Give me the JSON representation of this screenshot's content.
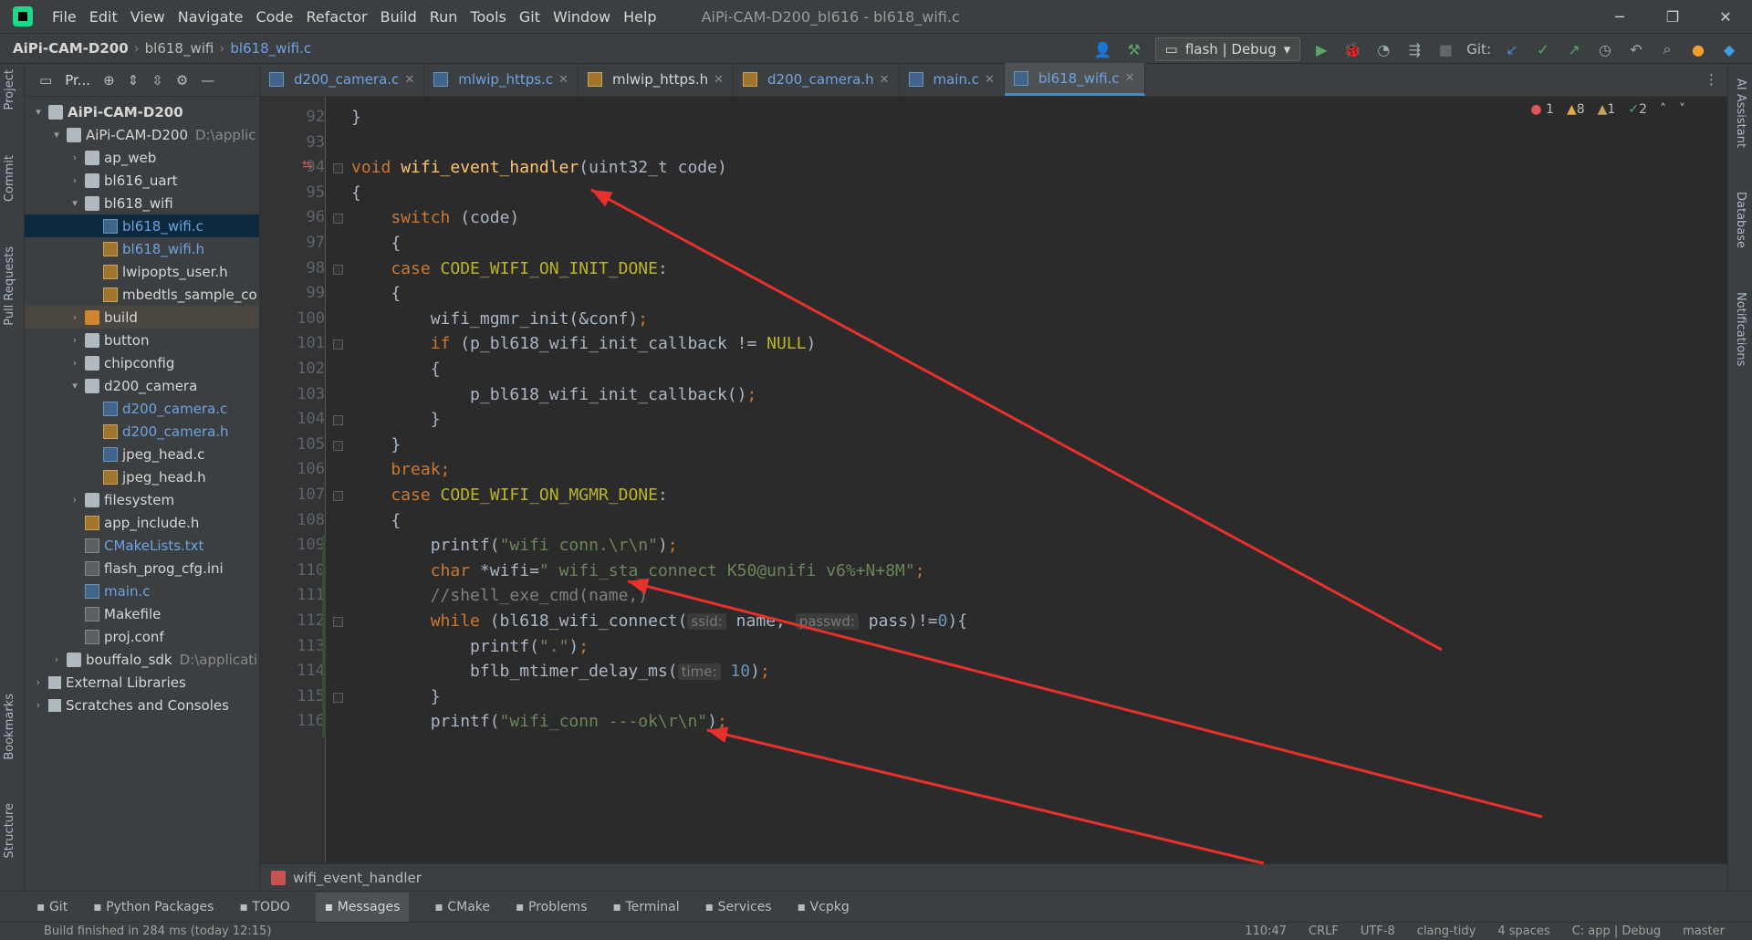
{
  "titlebar": {
    "menu": [
      "File",
      "Edit",
      "View",
      "Navigate",
      "Code",
      "Refactor",
      "Build",
      "Run",
      "Tools",
      "Git",
      "Window",
      "Help"
    ],
    "title": "AiPi-CAM-D200_bl616 - bl618_wifi.c"
  },
  "navbar": {
    "crumbs": [
      "AiPi-CAM-D200",
      "bl618_wifi",
      "bl618_wifi.c"
    ],
    "run_config": "flash | Debug",
    "git_label": "Git:"
  },
  "left_strip": [
    "Project",
    "Commit",
    "Pull Requests",
    "Bookmarks",
    "Structure"
  ],
  "right_strip": [
    "AI Assistant",
    "Database",
    "Notifications"
  ],
  "project_panel": {
    "title": "Pr...",
    "tree": [
      {
        "label": "AiPi-CAM-D200",
        "depth": 0,
        "arrow": "▾",
        "icon": "folder",
        "bold": true
      },
      {
        "label": "AiPi-CAM-D200",
        "extra": "D:\\applic",
        "depth": 1,
        "arrow": "▾",
        "icon": "folder"
      },
      {
        "label": "ap_web",
        "depth": 2,
        "arrow": "›",
        "icon": "folder"
      },
      {
        "label": "bl616_uart",
        "depth": 2,
        "arrow": "›",
        "icon": "folder"
      },
      {
        "label": "bl618_wifi",
        "depth": 2,
        "arrow": "▾",
        "icon": "folder"
      },
      {
        "label": "bl618_wifi.c",
        "depth": 3,
        "arrow": "",
        "icon": "c",
        "blue": true,
        "sel": true
      },
      {
        "label": "bl618_wifi.h",
        "depth": 3,
        "arrow": "",
        "icon": "h",
        "blue": true
      },
      {
        "label": "lwipopts_user.h",
        "depth": 3,
        "arrow": "",
        "icon": "h"
      },
      {
        "label": "mbedtls_sample_co",
        "depth": 3,
        "arrow": "",
        "icon": "h"
      },
      {
        "label": "build",
        "depth": 2,
        "arrow": "›",
        "icon": "folder-orange",
        "hl": true
      },
      {
        "label": "button",
        "depth": 2,
        "arrow": "›",
        "icon": "folder"
      },
      {
        "label": "chipconfig",
        "depth": 2,
        "arrow": "›",
        "icon": "folder"
      },
      {
        "label": "d200_camera",
        "depth": 2,
        "arrow": "▾",
        "icon": "folder"
      },
      {
        "label": "d200_camera.c",
        "depth": 3,
        "arrow": "",
        "icon": "c",
        "blue": true
      },
      {
        "label": "d200_camera.h",
        "depth": 3,
        "arrow": "",
        "icon": "h",
        "blue": true
      },
      {
        "label": "jpeg_head.c",
        "depth": 3,
        "arrow": "",
        "icon": "c"
      },
      {
        "label": "jpeg_head.h",
        "depth": 3,
        "arrow": "",
        "icon": "h"
      },
      {
        "label": "filesystem",
        "depth": 2,
        "arrow": "›",
        "icon": "folder"
      },
      {
        "label": "app_include.h",
        "depth": 2,
        "arrow": "",
        "icon": "h"
      },
      {
        "label": "CMakeLists.txt",
        "depth": 2,
        "arrow": "",
        "icon": "t",
        "blue": true
      },
      {
        "label": "flash_prog_cfg.ini",
        "depth": 2,
        "arrow": "",
        "icon": "t"
      },
      {
        "label": "main.c",
        "depth": 2,
        "arrow": "",
        "icon": "c",
        "blue": true
      },
      {
        "label": "Makefile",
        "depth": 2,
        "arrow": "",
        "icon": "t"
      },
      {
        "label": "proj.conf",
        "depth": 2,
        "arrow": "",
        "icon": "t"
      },
      {
        "label": "bouffalo_sdk",
        "extra": "D:\\applicati",
        "depth": 1,
        "arrow": "›",
        "icon": "folder"
      },
      {
        "label": "External Libraries",
        "depth": 0,
        "arrow": "›",
        "icon": "lib"
      },
      {
        "label": "Scratches and Consoles",
        "depth": 0,
        "arrow": "›",
        "icon": "lib"
      }
    ]
  },
  "tabs": [
    {
      "label": "d200_camera.c",
      "type": "c",
      "blue": true
    },
    {
      "label": "mlwip_https.c",
      "type": "c",
      "blue": true
    },
    {
      "label": "mlwip_https.h",
      "type": "h",
      "blue": false
    },
    {
      "label": "d200_camera.h",
      "type": "h",
      "blue": true
    },
    {
      "label": "main.c",
      "type": "c",
      "blue": true
    },
    {
      "label": "bl618_wifi.c",
      "type": "c",
      "blue": true,
      "active": true
    }
  ],
  "inspections": {
    "errors": "1",
    "warnings": "8",
    "weak": "1",
    "ok": "2"
  },
  "line_numbers": [
    "92",
    "93",
    "94",
    "95",
    "96",
    "97",
    "98",
    "99",
    "100",
    "101",
    "102",
    "103",
    "104",
    "105",
    "106",
    "107",
    "108",
    "109",
    "110",
    "111",
    "112",
    "113",
    "114",
    "115",
    "116"
  ],
  "code_lines": [
    [
      {
        "t": "}",
        "c": ""
      }
    ],
    [],
    [
      {
        "t": "void ",
        "c": "kw"
      },
      {
        "t": "wifi_event_handler",
        "c": "fn"
      },
      {
        "t": "(uint32_t code)",
        "c": ""
      }
    ],
    [
      {
        "t": "{",
        "c": ""
      }
    ],
    [
      {
        "t": "    switch ",
        "c": "kw"
      },
      {
        "t": "(code)",
        "c": ""
      }
    ],
    [
      {
        "t": "    {",
        "c": ""
      }
    ],
    [
      {
        "t": "    case ",
        "c": "kw"
      },
      {
        "t": "CODE_WIFI_ON_INIT_DONE",
        "c": "macro"
      },
      {
        "t": ":",
        "c": ""
      }
    ],
    [
      {
        "t": "    {",
        "c": ""
      }
    ],
    [
      {
        "t": "        wifi_mgmr_init(&conf)",
        "c": ""
      },
      {
        "t": ";",
        "c": "kw"
      }
    ],
    [
      {
        "t": "        if ",
        "c": "kw"
      },
      {
        "t": "(p_bl618_wifi_init_callback != ",
        "c": ""
      },
      {
        "t": "NULL",
        "c": "macro"
      },
      {
        "t": ")",
        "c": ""
      }
    ],
    [
      {
        "t": "        {",
        "c": ""
      }
    ],
    [
      {
        "t": "            p_bl618_wifi_init_callback()",
        "c": ""
      },
      {
        "t": ";",
        "c": "kw"
      }
    ],
    [
      {
        "t": "        }",
        "c": ""
      }
    ],
    [
      {
        "t": "    }",
        "c": ""
      }
    ],
    [
      {
        "t": "    break;",
        "c": "kw"
      }
    ],
    [
      {
        "t": "    case ",
        "c": "kw"
      },
      {
        "t": "CODE_WIFI_ON_MGMR_DONE",
        "c": "macro"
      },
      {
        "t": ":",
        "c": ""
      }
    ],
    [
      {
        "t": "    {",
        "c": ""
      }
    ],
    [
      {
        "t": "        printf(",
        "c": ""
      },
      {
        "t": "\"wifi conn.\\r\\n\"",
        "c": "str"
      },
      {
        "t": ")",
        "c": ""
      },
      {
        "t": ";",
        "c": "kw"
      }
    ],
    [
      {
        "t": "        char ",
        "c": "kw"
      },
      {
        "t": "*wifi=",
        "c": ""
      },
      {
        "t": "\" wifi_sta_connect K50@unifi v6%+N+8M\"",
        "c": "str"
      },
      {
        "t": ";",
        "c": "kw"
      }
    ],
    [
      {
        "t": "        //shell_exe_cmd(name,)",
        "c": "cmt"
      }
    ],
    [
      {
        "t": "        while ",
        "c": "kw"
      },
      {
        "t": "(bl618_wifi_connect(",
        "c": ""
      },
      {
        "t": "ssid:",
        "c": "hint"
      },
      {
        "t": " name, ",
        "c": ""
      },
      {
        "t": "passwd:",
        "c": "hint"
      },
      {
        "t": " pass)!=",
        "c": ""
      },
      {
        "t": "0",
        "c": "num"
      },
      {
        "t": "){",
        "c": ""
      }
    ],
    [
      {
        "t": "            printf(",
        "c": ""
      },
      {
        "t": "\".\"",
        "c": "str"
      },
      {
        "t": ")",
        "c": ""
      },
      {
        "t": ";",
        "c": "kw"
      }
    ],
    [
      {
        "t": "            bflb_mtimer_delay_ms(",
        "c": ""
      },
      {
        "t": "time:",
        "c": "hint"
      },
      {
        "t": " ",
        "c": ""
      },
      {
        "t": "10",
        "c": "num"
      },
      {
        "t": ")",
        "c": ""
      },
      {
        "t": ";",
        "c": "kw"
      }
    ],
    [
      {
        "t": "        }",
        "c": ""
      }
    ],
    [
      {
        "t": "        printf(",
        "c": ""
      },
      {
        "t": "\"wifi_conn ---ok\\r\\n\"",
        "c": "str"
      },
      {
        "t": ")",
        "c": ""
      },
      {
        "t": ";",
        "c": "kw"
      }
    ]
  ],
  "bottom_breadcrumb": "wifi_event_handler",
  "tool_windows": [
    {
      "label": "Git",
      "icon": "branch-icon"
    },
    {
      "label": "Python Packages",
      "icon": "layers-icon"
    },
    {
      "label": "TODO",
      "icon": "list-icon"
    },
    {
      "label": "Messages",
      "icon": "messages-icon",
      "active": true
    },
    {
      "label": "CMake",
      "icon": "triangle-icon"
    },
    {
      "label": "Problems",
      "icon": "info-icon"
    },
    {
      "label": "Terminal",
      "icon": "terminal-icon"
    },
    {
      "label": "Services",
      "icon": "services-icon"
    },
    {
      "label": "Vcpkg",
      "icon": "list-icon"
    }
  ],
  "status": {
    "message": "Build finished in 284 ms (today 12:15)",
    "right": [
      "110:47",
      "CRLF",
      "UTF-8",
      "clang-tidy",
      "4 spaces",
      "C: app | Debug",
      "master"
    ]
  },
  "colors": {
    "annotation_arrow": "#e8302c",
    "accent": "#4a88c7",
    "keyword": "#cc7832",
    "function": "#ffc66d",
    "string": "#6a8759",
    "macro": "#bbb529"
  }
}
